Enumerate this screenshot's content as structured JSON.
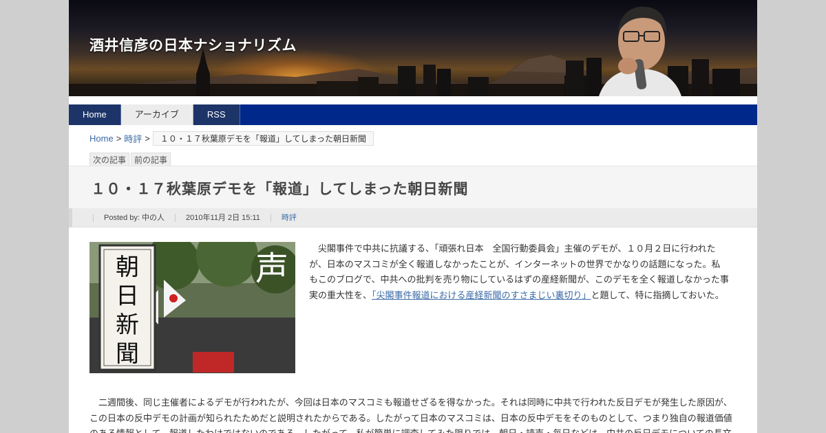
{
  "site": {
    "title": "酒井信彦の日本ナショナリズム"
  },
  "nav": [
    {
      "label": "Home"
    },
    {
      "label": "アーカイブ"
    },
    {
      "label": "RSS"
    }
  ],
  "breadcrumb": {
    "home": "Home",
    "sep": ">",
    "category": "時評",
    "current": "１０・１７秋葉原デモを「報道」してしまった朝日新聞"
  },
  "entry_nav": {
    "next": "次の記事",
    "prev": "前の記事"
  },
  "entry": {
    "title": "１０・１７秋葉原デモを「報道」してしまった朝日新聞",
    "posted_by": "Posted by: 中の人",
    "date": "2010年11月 2日 15:11",
    "category": "時評",
    "image_text": {
      "newspaper": [
        "朝",
        "日",
        "新",
        "聞"
      ],
      "voice": "声"
    },
    "para1_a": "尖閣事件で中共に抗議する、「頑張れ日本　全国行動委員会」主催のデモが、１０月２日に行われたが、日本のマスコミが全く報道しなかったことが、インターネットの世界でかなりの話題になった。私もこのブログで、中共への批判を売り物にしているはずの産経新聞が、このデモを全く報道しなかった事実の重大性を、",
    "para1_link": "「尖閣事件報道における産経新聞のすさまじい裏切り」",
    "para1_b": "と題して、特に指摘しておいた。",
    "para2": "二週間後、同じ主催者によるデモが行われたが、今回は日本のマスコミも報道せざるを得なかった。それは同時に中共で行われた反日デモが発生した原因が、この日本の反中デモの計画が知られたためだと説明されたからである。したがって日本のマスコミは、日本の反中デモをそのものとして、つまり独自の報道価値のある情報として、報道したわけではないのである。したがって、私が簡単に調査してみた限りでは、朝日・読売・毎日などは、中共の反日デモについての長文"
  },
  "colors": {
    "nav": "#00288a",
    "link": "#3a6aa6"
  }
}
